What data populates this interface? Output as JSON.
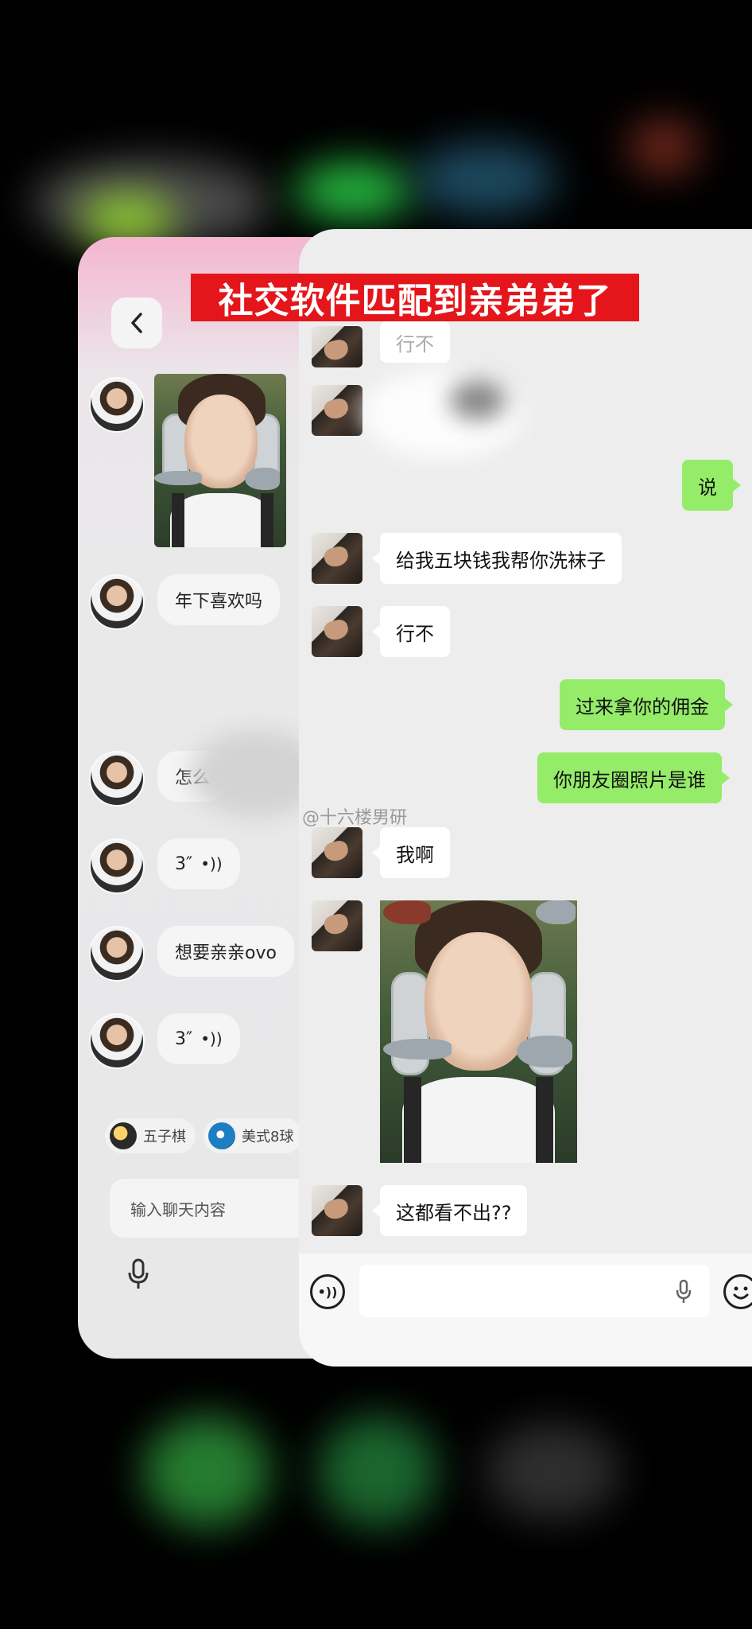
{
  "title_banner": "社交软件匹配到亲弟弟了",
  "watermark": "@十六楼男研",
  "left_card": {
    "messages": [
      {
        "type": "image"
      },
      {
        "type": "text",
        "text": "年下喜欢吗"
      },
      {
        "type": "text",
        "text": "怎么"
      },
      {
        "type": "voice",
        "text": "3″"
      },
      {
        "type": "text",
        "text": "想要亲亲ovo"
      },
      {
        "type": "voice",
        "text": "3″"
      }
    ],
    "chips": [
      {
        "label": "五子棋"
      },
      {
        "label": "美式8球"
      }
    ],
    "input_placeholder": "输入聊天内容"
  },
  "right_card": {
    "messages": [
      {
        "side": "left",
        "text": "行不"
      },
      {
        "side": "left",
        "text": ""
      },
      {
        "side": "right",
        "text": "说"
      },
      {
        "side": "left",
        "text": "给我五块钱我帮你洗袜子"
      },
      {
        "side": "left",
        "text": "行不"
      },
      {
        "side": "right",
        "text": "过来拿你的佣金"
      },
      {
        "side": "right",
        "text": "你朋友圈照片是谁"
      },
      {
        "side": "left",
        "text": "我啊"
      },
      {
        "side": "left",
        "type": "image"
      },
      {
        "side": "left",
        "text": "这都看不出??"
      }
    ]
  },
  "colors": {
    "sent_bubble": "#95ec69",
    "received_bubble": "#ffffff",
    "banner": "#e4161b"
  }
}
